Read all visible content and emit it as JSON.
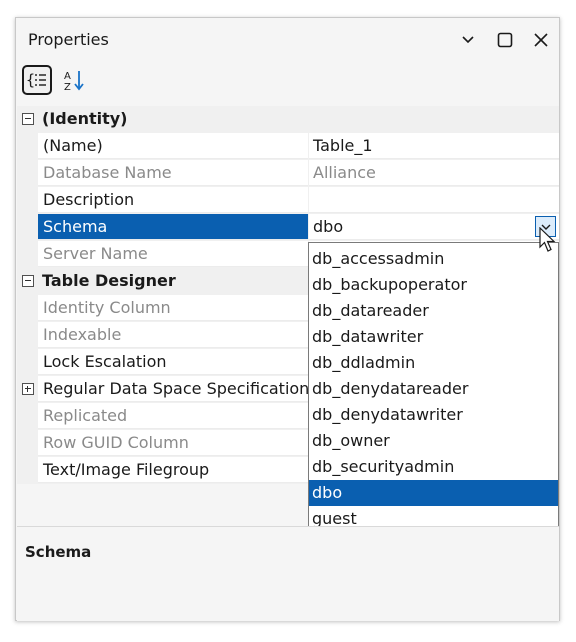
{
  "window": {
    "title": "Properties"
  },
  "toolbar": {
    "categorized_label": "Categorized",
    "alphabetical_label": "Alphabetical"
  },
  "grid": {
    "categories": [
      {
        "label": "(Identity)",
        "expanded": true,
        "properties": [
          {
            "name": "(Name)",
            "value": "Table_1",
            "readonly": false
          },
          {
            "name": "Database Name",
            "value": "Alliance",
            "readonly": true
          },
          {
            "name": "Description",
            "value": "",
            "readonly": false
          },
          {
            "name": "Schema",
            "value": "dbo",
            "readonly": false,
            "selected": true
          },
          {
            "name": "Server Name",
            "value": "",
            "readonly": true
          }
        ]
      },
      {
        "label": "Table Designer",
        "expanded": true,
        "properties": [
          {
            "name": "Identity Column",
            "value": "",
            "readonly": true
          },
          {
            "name": "Indexable",
            "value": "",
            "readonly": true
          },
          {
            "name": "Lock Escalation",
            "value": "",
            "readonly": false
          },
          {
            "name": "Regular Data Space Specification",
            "value": "",
            "readonly": false,
            "expandable": true
          },
          {
            "name": "Replicated",
            "value": "",
            "readonly": true
          },
          {
            "name": "Row GUID Column",
            "value": "",
            "readonly": true
          },
          {
            "name": "Text/Image Filegroup",
            "value": "",
            "readonly": false
          }
        ]
      }
    ]
  },
  "schema_dropdown": {
    "options": [
      "db_accessadmin",
      "db_backupoperator",
      "db_datareader",
      "db_datawriter",
      "db_ddladmin",
      "db_denydatareader",
      "db_denydatawriter",
      "db_owner",
      "db_securityadmin",
      "dbo",
      "guest"
    ],
    "selected": "dbo"
  },
  "description": {
    "title": "Schema"
  },
  "colors": {
    "selection": "#0a5fb0",
    "readonly_text": "#8a8a8a",
    "grid_background": "#f0f0f0"
  }
}
